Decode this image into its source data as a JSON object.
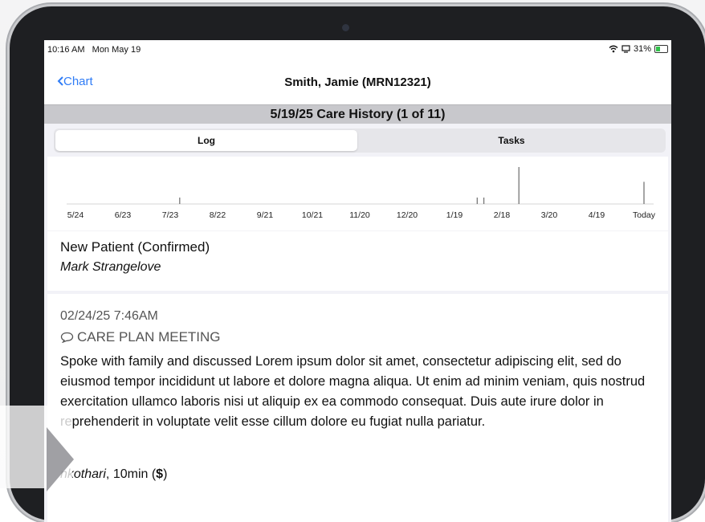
{
  "statusbar": {
    "time": "10:16 AM",
    "date": "Mon May 19",
    "battery": "31%",
    "battery_color": "#31c24a"
  },
  "nav": {
    "back_label": "Chart",
    "title": "Smith, Jamie (MRN12321)",
    "accent_color": "#2f7cf6"
  },
  "section": {
    "title": "5/19/25 Care History (1 of 11)"
  },
  "tabs": [
    {
      "label": "Log",
      "selected": true
    },
    {
      "label": "Tasks",
      "selected": false
    }
  ],
  "chart_data": {
    "type": "timeline",
    "tick_labels": [
      "5/24",
      "6/23",
      "7/23",
      "8/22",
      "9/21",
      "10/21",
      "11/20",
      "12/20",
      "1/19",
      "2/18",
      "3/20",
      "4/19",
      "Today"
    ],
    "events": [
      {
        "position": 2.2,
        "magnitude": 0.15
      },
      {
        "position": 8.48,
        "magnitude": 0.15
      },
      {
        "position": 8.62,
        "magnitude": 0.15
      },
      {
        "position": 9.36,
        "magnitude": 1.0
      },
      {
        "position": 12.0,
        "magnitude": 0.6
      }
    ]
  },
  "entries": [
    {
      "title": "New  Patient (Confirmed)",
      "author": "Mark Strangelove"
    },
    {
      "datetime": "02/24/25 7:46AM",
      "type": "CARE PLAN MEETING",
      "body": "Spoke with family and discussed Lorem ipsum dolor sit amet, consectetur adipiscing elit, sed do eiusmod tempor incididunt ut labore et dolore magna aliqua. Ut enim ad minim veniam, quis nostrud exercitation ullamco laboris nisi ut aliquip ex ea commodo consequat. Duis aute irure dolor in reprehenderit in voluptate velit esse cillum dolore eu fugiat nulla pariatur.",
      "author": "nkothari",
      "duration": ", 10min (",
      "billing": "$",
      "duration_end": ")"
    }
  ]
}
